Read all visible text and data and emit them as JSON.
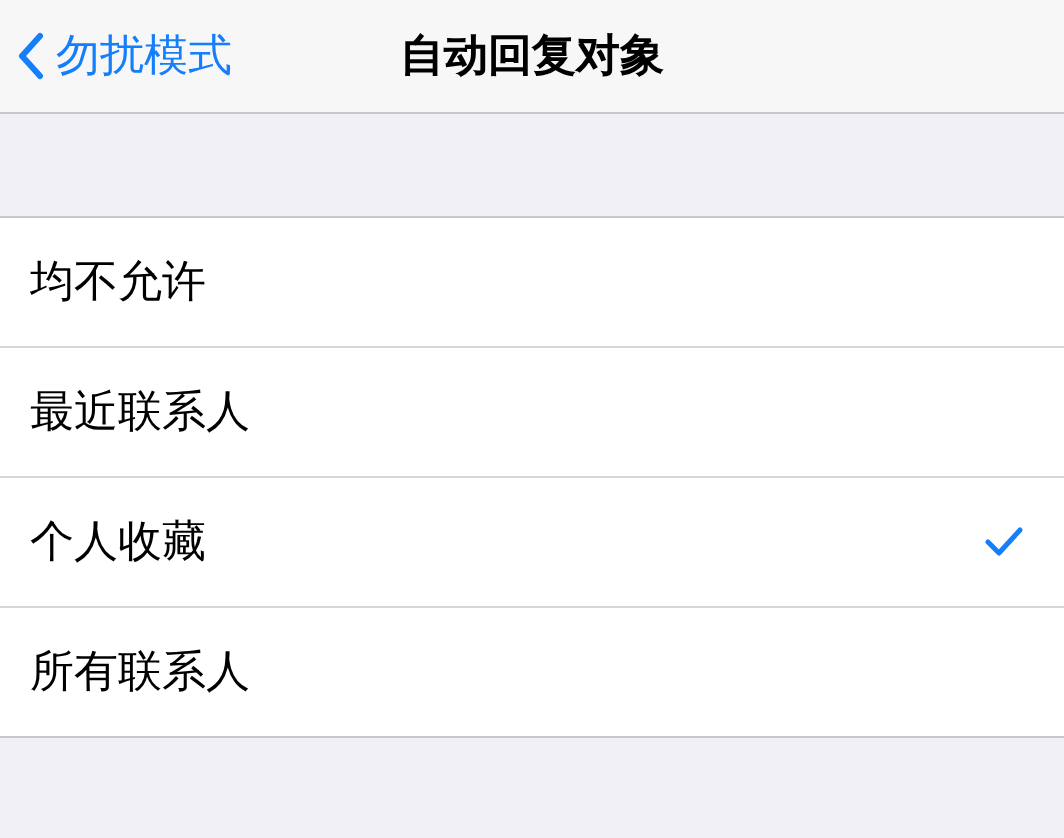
{
  "nav": {
    "back": "勿扰模式",
    "title": "自动回复对象"
  },
  "options": [
    {
      "label": "均不允许",
      "selected": false
    },
    {
      "label": "最近联系人",
      "selected": false
    },
    {
      "label": "个人收藏",
      "selected": true
    },
    {
      "label": "所有联系人",
      "selected": false
    }
  ]
}
